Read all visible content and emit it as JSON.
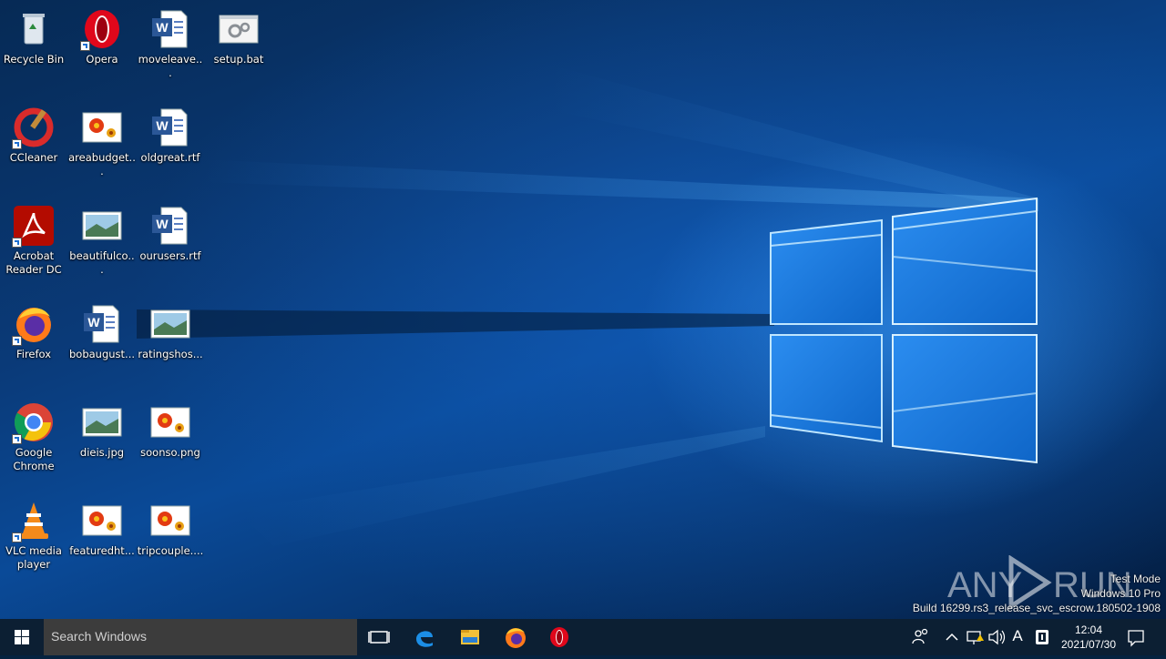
{
  "desktop": {
    "icons": [
      {
        "label": "Recycle Bin",
        "icon": "recycle-bin-icon"
      },
      {
        "label": "Opera",
        "icon": "opera-icon"
      },
      {
        "label": "moveleave...",
        "icon": "word-document-icon"
      },
      {
        "label": "setup.bat",
        "icon": "batch-file-icon"
      },
      {
        "label": "CCleaner",
        "icon": "ccleaner-icon"
      },
      {
        "label": "areabudget...",
        "icon": "image-file-icon"
      },
      {
        "label": "oldgreat.rtf",
        "icon": "word-document-icon"
      },
      {
        "label": "Acrobat Reader DC",
        "icon": "acrobat-icon"
      },
      {
        "label": "beautifulco...",
        "icon": "photo-file-icon"
      },
      {
        "label": "ourusers.rtf",
        "icon": "word-document-icon"
      },
      {
        "label": "Firefox",
        "icon": "firefox-icon"
      },
      {
        "label": "bobaugust...",
        "icon": "word-document-icon"
      },
      {
        "label": "ratingshos...",
        "icon": "photo-file-icon"
      },
      {
        "label": "Google Chrome",
        "icon": "chrome-icon"
      },
      {
        "label": "dieis.jpg",
        "icon": "photo-file-icon"
      },
      {
        "label": "soonso.png",
        "icon": "image-file-icon"
      },
      {
        "label": "VLC media player",
        "icon": "vlc-icon"
      },
      {
        "label": "featuredht...",
        "icon": "image-file-icon"
      },
      {
        "label": "tripcouple....",
        "icon": "image-file-icon"
      }
    ]
  },
  "watermark": {
    "brand": "ANY RUN",
    "line1": "Test Mode",
    "line2": "Windows 10 Pro",
    "line3": "Build 16299.rs3_release_svc_escrow.180502-1908"
  },
  "taskbar": {
    "search_placeholder": "Search Windows",
    "pinned": [
      "task-view-icon",
      "edge-icon",
      "file-explorer-icon",
      "firefox-icon",
      "opera-icon"
    ],
    "tray": [
      "people-icon",
      "chevron-up-icon",
      "network-icon",
      "volume-icon",
      "ime-icon",
      "security-icon"
    ],
    "ime_label": "A",
    "clock_time": "12:04",
    "clock_date": "2021/07/30",
    "notification_icon": "action-center-icon"
  },
  "colors": {
    "taskbar": "#0c1f33",
    "search_box": "#3c3c3c",
    "accent_light": "#9fdcff"
  }
}
